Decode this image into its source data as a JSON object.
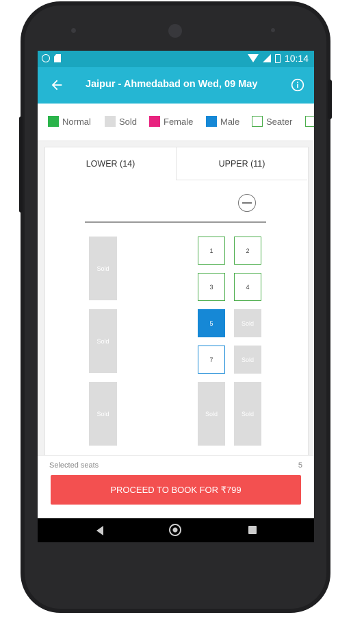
{
  "status_bar": {
    "time": "10:14"
  },
  "app_bar": {
    "title": "Jaipur - Ahmedabad on Wed, 09 May"
  },
  "legend": [
    {
      "label": "Normal",
      "color": "#2bb44b",
      "style": "fill"
    },
    {
      "label": "Sold",
      "color": "#dcdcdc",
      "style": "fill"
    },
    {
      "label": "Female",
      "color": "#e8237f",
      "style": "fill"
    },
    {
      "label": "Male",
      "color": "#1688d6",
      "style": "fill"
    },
    {
      "label": "Seater",
      "color": "#4cae4c",
      "style": "outline"
    }
  ],
  "tabs": {
    "lower": "LOWER (14)",
    "upper": "UPPER (11)"
  },
  "seats": {
    "sold_label": "Sold",
    "s1": "1",
    "s2": "2",
    "s3": "3",
    "s4": "4",
    "s5": "5",
    "s7": "7"
  },
  "footer": {
    "selected_label": "Selected seats",
    "selected_value": "5",
    "proceed_label": "PROCEED TO BOOK FOR ₹799"
  },
  "colors": {
    "accent": "#25b6d3",
    "status": "#1aa6bf",
    "cta": "#f35050",
    "male": "#1688d6",
    "normal": "#2bb44b"
  }
}
